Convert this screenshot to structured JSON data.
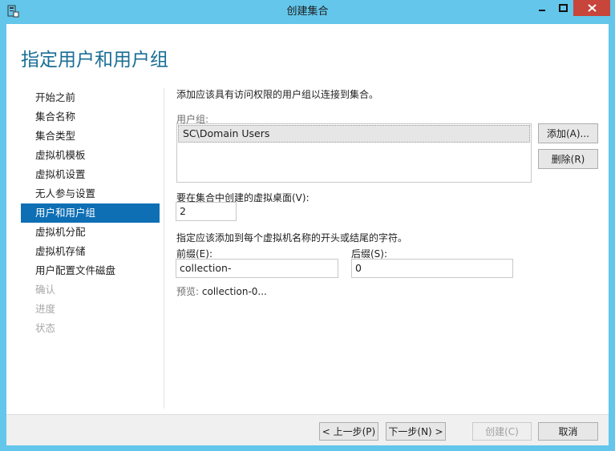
{
  "window": {
    "title": "创建集合"
  },
  "page": {
    "title": "指定用户和用户组"
  },
  "nav": {
    "items": [
      {
        "label": "开始之前",
        "state": "normal"
      },
      {
        "label": "集合名称",
        "state": "normal"
      },
      {
        "label": "集合类型",
        "state": "normal"
      },
      {
        "label": "虚拟机模板",
        "state": "normal"
      },
      {
        "label": "虚拟机设置",
        "state": "normal"
      },
      {
        "label": "无人参与设置",
        "state": "normal"
      },
      {
        "label": "用户和用户组",
        "state": "active"
      },
      {
        "label": "虚拟机分配",
        "state": "normal"
      },
      {
        "label": "虚拟机存储",
        "state": "normal"
      },
      {
        "label": "用户配置文件磁盘",
        "state": "normal"
      },
      {
        "label": "确认",
        "state": "disabled"
      },
      {
        "label": "进度",
        "state": "disabled"
      },
      {
        "label": "状态",
        "state": "disabled"
      }
    ]
  },
  "main": {
    "instruction": "添加应该具有访问权限的用户组以连接到集合。",
    "groups_label": "用户组:",
    "groups": [
      "SC\\Domain Users"
    ],
    "add_button": "添加(A)...",
    "remove_button": "删除(R)",
    "count_label": "要在集合中创建的虚拟桌面(V):",
    "count_value": "2",
    "name_instruction": "指定应该添加到每个虚拟机名称的开头或结尾的字符。",
    "prefix_label": "前缀(E):",
    "prefix_value": "collection-",
    "suffix_label": "后缀(S):",
    "suffix_value": "0",
    "preview_label": "预览:",
    "preview_value": "collection-0..."
  },
  "footer": {
    "prev": "< 上一步(P)",
    "next": "下一步(N) >",
    "create": "创建(C)",
    "cancel": "取消"
  },
  "colors": {
    "titlebar": "#63c6ea",
    "accent": "#0e6fb5",
    "heading": "#1a6e96",
    "close": "#c7453b"
  }
}
